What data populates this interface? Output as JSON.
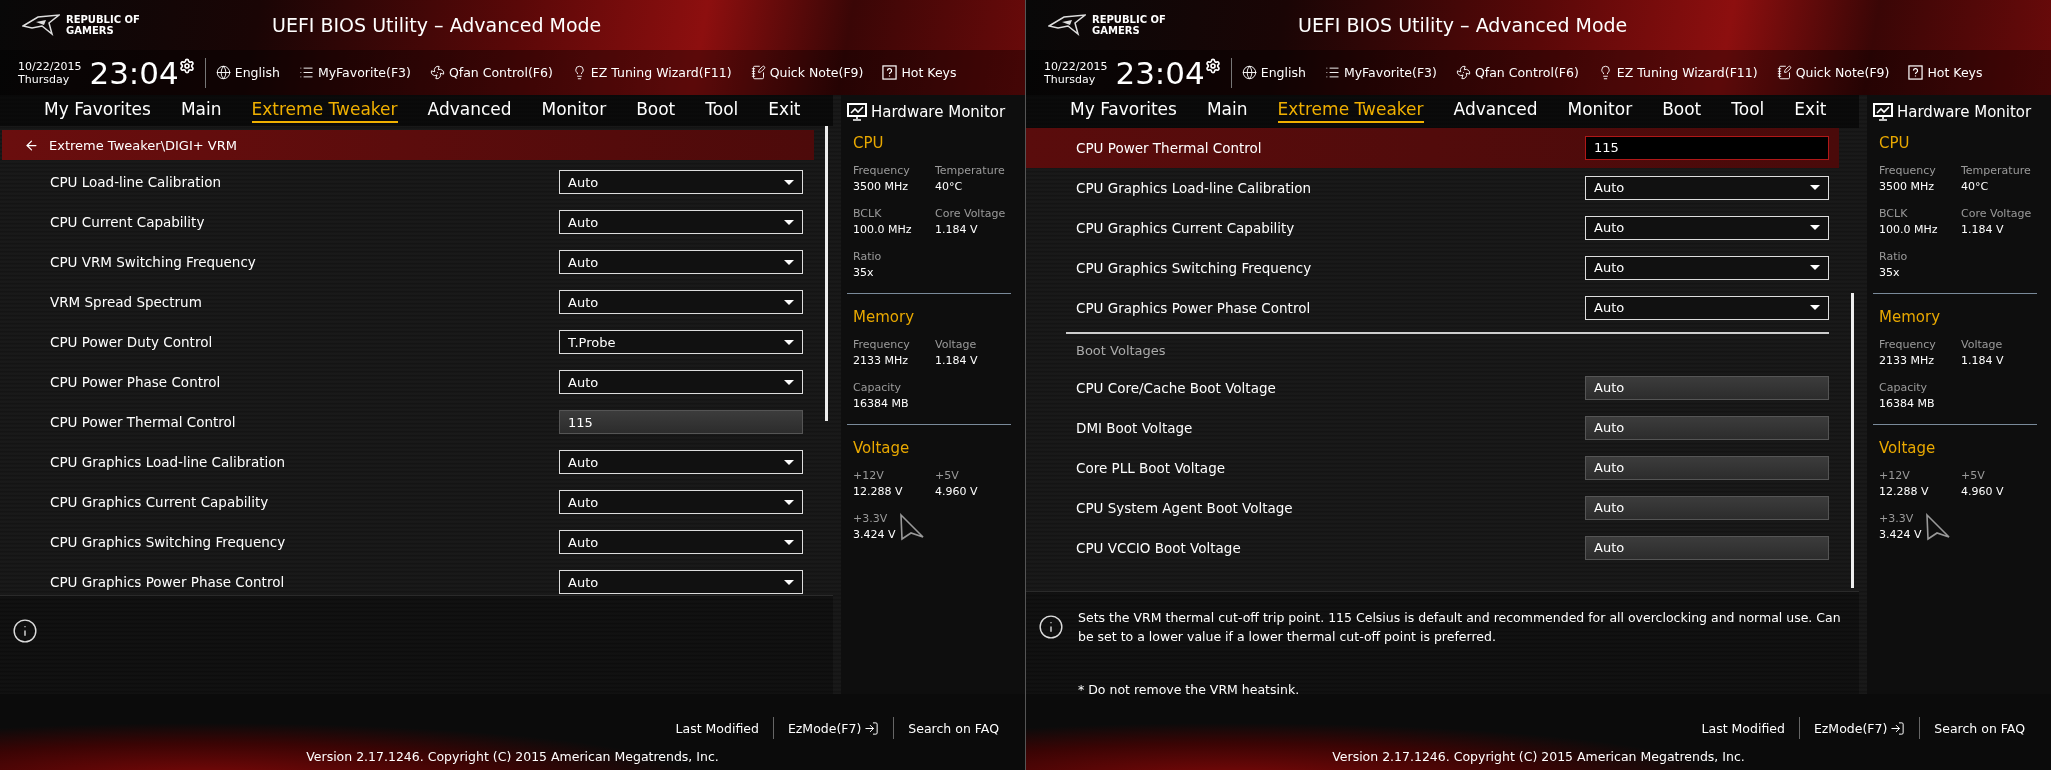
{
  "screens": [
    {
      "logo": [
        "REPUBLIC OF",
        "GAMERS"
      ],
      "title": "UEFI BIOS Utility – Advanced Mode",
      "date": "10/22/2015",
      "day": "Thursday",
      "time": "23:04",
      "toolbar": [
        {
          "kind": "language",
          "label": "English"
        },
        {
          "kind": "favorite",
          "label": "MyFavorite(F3)"
        },
        {
          "kind": "fan",
          "label": "Qfan Control(F6)"
        },
        {
          "kind": "wizard",
          "label": "EZ Tuning Wizard(F11)"
        },
        {
          "kind": "note",
          "label": "Quick Note(F9)"
        },
        {
          "kind": "hotkeys",
          "label": "Hot Keys"
        }
      ],
      "tabs": [
        {
          "label": "My Favorites",
          "selected": false
        },
        {
          "label": "Main",
          "selected": false
        },
        {
          "label": "Extreme Tweaker",
          "selected": true
        },
        {
          "label": "Advanced",
          "selected": false
        },
        {
          "label": "Monitor",
          "selected": false
        },
        {
          "label": "Boot",
          "selected": false
        },
        {
          "label": "Tool",
          "selected": false
        },
        {
          "label": "Exit",
          "selected": false
        }
      ],
      "breadcrumb": "Extreme Tweaker\\DIGI+ VRM",
      "items": [
        {
          "kind": "dropdown",
          "label": "CPU Load-line Calibration",
          "value": "Auto",
          "selected": false
        },
        {
          "kind": "dropdown",
          "label": "CPU Current Capability",
          "value": "Auto",
          "selected": false
        },
        {
          "kind": "dropdown",
          "label": "CPU VRM Switching Frequency",
          "value": "Auto",
          "selected": false
        },
        {
          "kind": "dropdown",
          "label": "VRM Spread Spectrum",
          "value": "Auto",
          "selected": false
        },
        {
          "kind": "dropdown",
          "label": "CPU Power Duty Control",
          "value": "T.Probe",
          "selected": false
        },
        {
          "kind": "dropdown",
          "label": "CPU Power Phase Control",
          "value": "Auto",
          "selected": false
        },
        {
          "kind": "field",
          "label": "CPU Power Thermal Control",
          "value": "115",
          "selected": false
        },
        {
          "kind": "dropdown",
          "label": "CPU Graphics Load-line Calibration",
          "value": "Auto",
          "selected": false
        },
        {
          "kind": "dropdown",
          "label": "CPU Graphics Current Capability",
          "value": "Auto",
          "selected": false
        },
        {
          "kind": "dropdown",
          "label": "CPU Graphics Switching Frequency",
          "value": "Auto",
          "selected": false
        },
        {
          "kind": "dropdown",
          "label": "CPU Graphics Power Phase Control",
          "value": "Auto",
          "selected": false
        }
      ],
      "monitor": {
        "title": "Hardware Monitor",
        "sections": [
          {
            "title": "CPU",
            "stats": [
              {
                "label": "Frequency",
                "value": "3500 MHz"
              },
              {
                "label": "Temperature",
                "value": "40°C"
              },
              {
                "label": "BCLK",
                "value": "100.0 MHz"
              },
              {
                "label": "Core Voltage",
                "value": "1.184 V"
              },
              {
                "label": "Ratio",
                "value": "35x"
              }
            ]
          },
          {
            "title": "Memory",
            "stats": [
              {
                "label": "Frequency",
                "value": "2133 MHz"
              },
              {
                "label": "Voltage",
                "value": "1.184 V"
              },
              {
                "label": "Capacity",
                "value": "16384 MB"
              }
            ]
          },
          {
            "title": "Voltage",
            "stats": [
              {
                "label": "+12V",
                "value": "12.288 V"
              },
              {
                "label": "+5V",
                "value": "4.960 V"
              },
              {
                "label": "+3.3V",
                "value": "3.424 V"
              }
            ]
          }
        ]
      },
      "footer_links": [
        "Last Modified",
        "EzMode(F7)",
        "Search on FAQ"
      ],
      "version": "Version 2.17.1246. Copyright (C) 2015 American Megatrends, Inc."
    },
    {
      "logo": [
        "REPUBLIC OF",
        "GAMERS"
      ],
      "title": "UEFI BIOS Utility – Advanced Mode",
      "date": "10/22/2015",
      "day": "Thursday",
      "time": "23:04",
      "toolbar": [
        {
          "kind": "language",
          "label": "English"
        },
        {
          "kind": "favorite",
          "label": "MyFavorite(F3)"
        },
        {
          "kind": "fan",
          "label": "Qfan Control(F6)"
        },
        {
          "kind": "wizard",
          "label": "EZ Tuning Wizard(F11)"
        },
        {
          "kind": "note",
          "label": "Quick Note(F9)"
        },
        {
          "kind": "hotkeys",
          "label": "Hot Keys"
        }
      ],
      "tabs": [
        {
          "label": "My Favorites",
          "selected": false
        },
        {
          "label": "Main",
          "selected": false
        },
        {
          "label": "Extreme Tweaker",
          "selected": true
        },
        {
          "label": "Advanced",
          "selected": false
        },
        {
          "label": "Monitor",
          "selected": false
        },
        {
          "label": "Boot",
          "selected": false
        },
        {
          "label": "Tool",
          "selected": false
        },
        {
          "label": "Exit",
          "selected": false
        }
      ],
      "items": [
        {
          "kind": "field",
          "label": "CPU Power Thermal Control",
          "value": "115",
          "selected": true
        },
        {
          "kind": "dropdown",
          "label": "CPU Graphics Load-line Calibration",
          "value": "Auto",
          "selected": false
        },
        {
          "kind": "dropdown",
          "label": "CPU Graphics Current Capability",
          "value": "Auto",
          "selected": false
        },
        {
          "kind": "dropdown",
          "label": "CPU Graphics Switching Frequency",
          "value": "Auto",
          "selected": false
        },
        {
          "kind": "dropdown",
          "label": "CPU Graphics Power Phase Control",
          "value": "Auto",
          "selected": false
        },
        {
          "kind": "section",
          "label": "Boot Voltages"
        },
        {
          "kind": "field",
          "label": "CPU Core/Cache Boot Voltage",
          "value": "Auto",
          "selected": false
        },
        {
          "kind": "field",
          "label": "DMI Boot Voltage",
          "value": "Auto",
          "selected": false
        },
        {
          "kind": "field",
          "label": "Core PLL Boot Voltage",
          "value": "Auto",
          "selected": false
        },
        {
          "kind": "field",
          "label": "CPU System Agent Boot Voltage",
          "value": "Auto",
          "selected": false
        },
        {
          "kind": "field",
          "label": "CPU VCCIO Boot Voltage",
          "value": "Auto",
          "selected": false
        }
      ],
      "help": {
        "text": "Sets the VRM thermal cut-off trip point. 115 Celsius is default and recommended for all overclocking and normal use. Can be set to a lower value if a lower thermal cut-off point is preferred.",
        "note": "* Do not remove the VRM heatsink."
      },
      "monitor": {
        "title": "Hardware Monitor",
        "sections": [
          {
            "title": "CPU",
            "stats": [
              {
                "label": "Frequency",
                "value": "3500 MHz"
              },
              {
                "label": "Temperature",
                "value": "40°C"
              },
              {
                "label": "BCLK",
                "value": "100.0 MHz"
              },
              {
                "label": "Core Voltage",
                "value": "1.184 V"
              },
              {
                "label": "Ratio",
                "value": "35x"
              }
            ]
          },
          {
            "title": "Memory",
            "stats": [
              {
                "label": "Frequency",
                "value": "2133 MHz"
              },
              {
                "label": "Voltage",
                "value": "1.184 V"
              },
              {
                "label": "Capacity",
                "value": "16384 MB"
              }
            ]
          },
          {
            "title": "Voltage",
            "stats": [
              {
                "label": "+12V",
                "value": "12.288 V"
              },
              {
                "label": "+5V",
                "value": "4.960 V"
              },
              {
                "label": "+3.3V",
                "value": "3.424 V"
              }
            ]
          }
        ]
      },
      "footer_links": [
        "Last Modified",
        "EzMode(F7)",
        "Search on FAQ"
      ],
      "version": "Version 2.17.1246. Copyright (C) 2015 American Megatrends, Inc."
    }
  ]
}
